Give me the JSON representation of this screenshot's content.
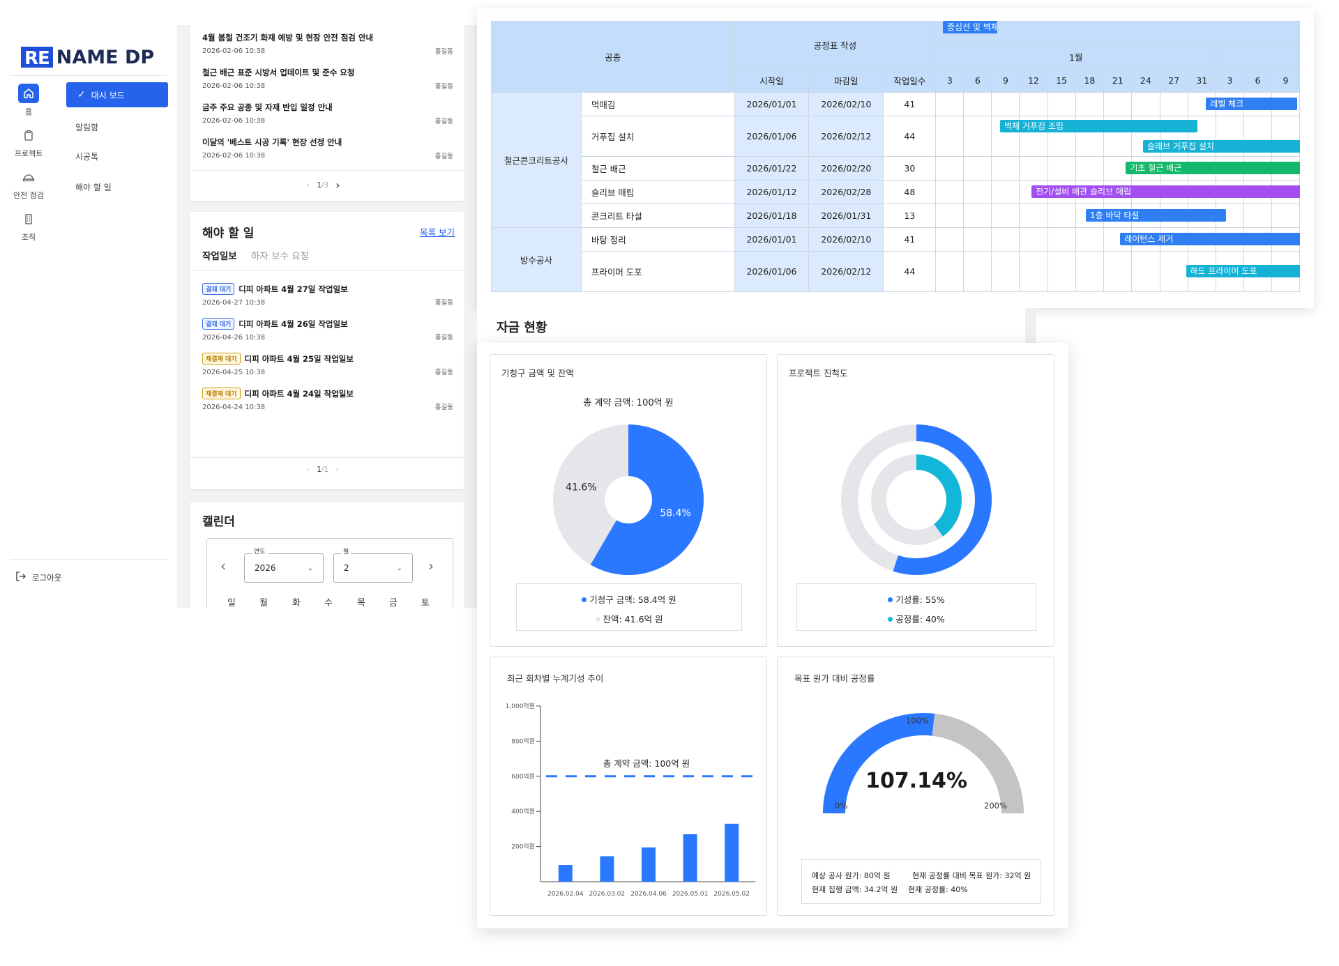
{
  "brand": {
    "logo_re": "RE",
    "logo_name": "NAME DP"
  },
  "rail": [
    {
      "label": "홈",
      "icon": "home-icon"
    },
    {
      "label": "프로젝트",
      "icon": "clipboard-icon"
    },
    {
      "label": "안전 점검",
      "icon": "helmet-icon"
    },
    {
      "label": "조직",
      "icon": "building-icon"
    }
  ],
  "submenu": {
    "active": "대시 보드",
    "items": [
      "알림함",
      "시공톡",
      "해야 할 일"
    ]
  },
  "logout": "로그아웃",
  "notices": [
    {
      "title": "4월 봄철 건조기 화재 예방 및 현장 안전 점검 안내",
      "date": "2026-02-06 10:38",
      "author": "홍길동"
    },
    {
      "title": "철근 배근 표준 시방서 업데이트 및 준수 요청",
      "date": "2026-02-06 10:38",
      "author": "홍길동"
    },
    {
      "title": "금주 주요 공종 및 자재 반입 일정 안내",
      "date": "2026-02-06 10:38",
      "author": "홍길동"
    },
    {
      "title": "이달의 '베스트 시공 기록' 현장 선정 안내",
      "date": "2026-02-06 10:38",
      "author": "홍길동"
    }
  ],
  "notice_pager": {
    "current": "1",
    "total": "/3"
  },
  "todo": {
    "title": "해야 할 일",
    "link": "목록 보기",
    "tabs": [
      "작업일보",
      "하자 보수 요청"
    ],
    "items": [
      {
        "badge": "결재 대기",
        "title": "디피 아파트 4월 27일 작업일보",
        "date": "2026-04-27 10:38",
        "author": "홍길동"
      },
      {
        "badge": "결재 대기",
        "title": "디피 아파트 4월 26일 작업일보",
        "date": "2026-04-26 10:38",
        "author": "홍길동"
      },
      {
        "badge": "재결재 대기",
        "title": "디피 아파트 4월 25일 작업일보",
        "date": "2026-04-25 10:38",
        "author": "홍길동"
      },
      {
        "badge": "재결재 대기",
        "title": "디피 아파트 4월 24일 작업일보",
        "date": "2026-04-24 10:38",
        "author": "홍길동"
      }
    ],
    "pager": {
      "current": "1",
      "total": "/1"
    }
  },
  "calendar": {
    "title": "캘린더",
    "year_label": "연도",
    "year": "2026",
    "month_label": "월",
    "month": "2",
    "weekdays": [
      "일",
      "월",
      "화",
      "수",
      "목",
      "금",
      "토"
    ]
  },
  "gantt": {
    "h_trade": "공종",
    "h_schedule": "공정표 작성",
    "h_month": "1월",
    "h_start": "시작일",
    "h_end": "마감일",
    "h_days": "작업일수",
    "day_cols": [
      "3",
      "6",
      "9",
      "12",
      "15",
      "18",
      "21",
      "24",
      "27",
      "31",
      "3",
      "6",
      "9"
    ],
    "groups": [
      {
        "name": "철근콘크리트공사",
        "rows": [
          {
            "name": "먹매김",
            "start": "2026/01/01",
            "end": "2026/02/10",
            "days": "41"
          },
          {
            "name": "거푸집 설치",
            "start": "2026/01/06",
            "end": "2026/02/12",
            "days": "44"
          },
          {
            "name": "철근 배근",
            "start": "2026/01/22",
            "end": "2026/02/20",
            "days": "30"
          },
          {
            "name": "슬리브 매립",
            "start": "2026/01/12",
            "end": "2026/02/28",
            "days": "48"
          },
          {
            "name": "콘크리트 타설",
            "start": "2026/01/18",
            "end": "2026/01/31",
            "days": "13"
          }
        ]
      },
      {
        "name": "방수공사",
        "rows": [
          {
            "name": "바탕 정리",
            "start": "2026/01/01",
            "end": "2026/02/10",
            "days": "41"
          },
          {
            "name": "프라이머 도포",
            "start": "2026/01/06",
            "end": "2026/02/12",
            "days": "44"
          }
        ]
      }
    ],
    "bars": [
      {
        "label": "중심선 및 벽체선 먹매김",
        "color": "#2f7ff2",
        "row": 0
      },
      {
        "label": "레벨 체크",
        "color": "#2f7ff2",
        "row": 0
      },
      {
        "label": "벽체 거푸집 조립",
        "color": "#16b2d6",
        "row": 1
      },
      {
        "label": "슬래브 거푸집 설치",
        "color": "#16b2d6",
        "row": 1
      },
      {
        "label": "기초 철근 배근",
        "color": "#13b86b",
        "row": 2
      },
      {
        "label": "전기/설비 배관 슬리브 매립",
        "color": "#a24ef0",
        "row": 3
      },
      {
        "label": "1층 바닥 타설",
        "color": "#2f7ff2",
        "row": 4
      },
      {
        "label": "레이턴스 제거",
        "color": "#2f7ff2",
        "row": 5
      },
      {
        "label": "하도 프라이머 도포",
        "color": "#16b2d6",
        "row": 6
      }
    ]
  },
  "fund": {
    "title": "자금 현황",
    "billing": {
      "title": "기청구 금액 및 잔액",
      "total": "총 계약 금액: 100억 원",
      "slices": [
        {
          "label": "기청구 금액: 58.4억 원",
          "pct_label": "58.4%",
          "value": 58.4,
          "color": "#2a78ff"
        },
        {
          "label": "잔액: 41.6억 원",
          "pct_label": "41.6%",
          "value": 41.6,
          "color": "#e4e6ea"
        }
      ]
    },
    "progress": {
      "title": "프로젝트 진척도",
      "rings": [
        {
          "label": "기성률: 55%",
          "value": 55,
          "color": "#2a78ff"
        },
        {
          "label": "공정률: 40%",
          "value": 40,
          "color": "#12b6d8"
        }
      ]
    },
    "cumulative": {
      "title": "최근 회차별 누계기성 추이",
      "ref_label": "총 계약 금액: 100억 원",
      "y_ticks": [
        "1,000억원",
        "800억원",
        "600억원",
        "400억원",
        "200억원"
      ]
    },
    "target": {
      "title": "목표 원가 대비 공정률",
      "value_label": "107.14%",
      "value": 107.14,
      "min_label": "0%",
      "mid_label": "100%",
      "max_label": "200%",
      "info": [
        "예상 공사 원가: 80억 원",
        "현재 공정률 대비 목표 원가: 32억 원",
        "현재 집행 금액: 34.2억 원",
        "현재 공정률: 40%"
      ]
    }
  },
  "chart_data": {
    "type": "bar",
    "title": "최근 회차별 누계기성 추이",
    "categories": [
      "2026.02.04",
      "2026.03.02",
      "2026.04.06",
      "2026.05.01",
      "2026.05.02"
    ],
    "values": [
      95,
      145,
      195,
      270,
      330
    ],
    "reference_line": {
      "label": "총 계약 금액: 100억 원",
      "value": 600
    },
    "y_unit": "억원",
    "ylim": [
      0,
      1000
    ],
    "color": "#2a78ff",
    "grid": false
  }
}
